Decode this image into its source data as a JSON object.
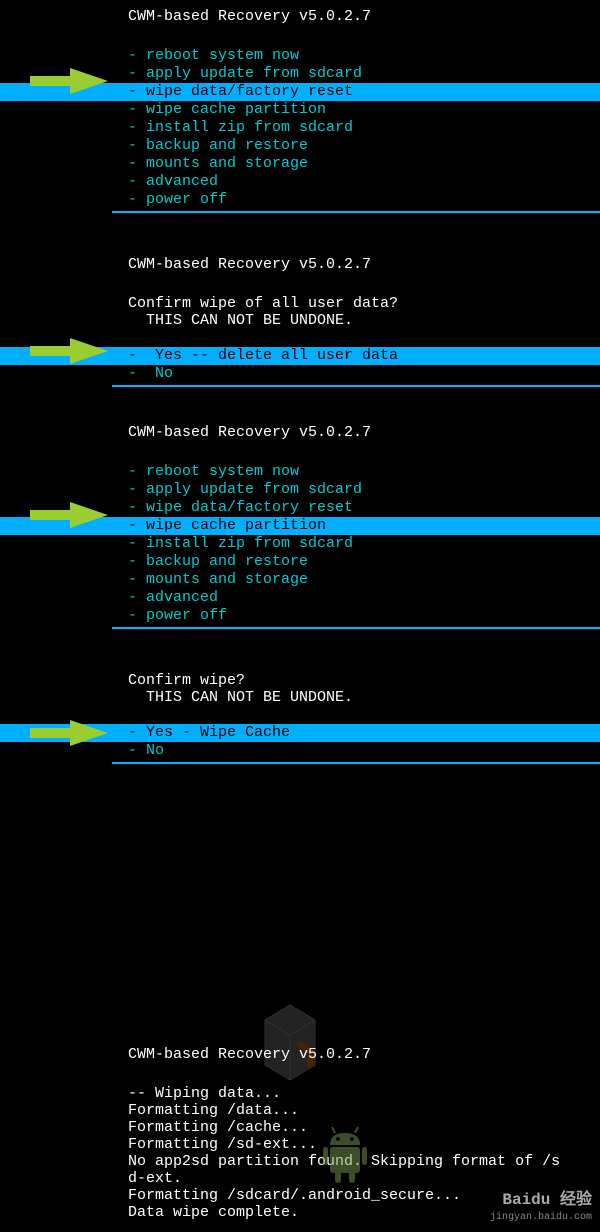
{
  "header": "CWM-based Recovery v5.0.2.7",
  "menu1": {
    "items": [
      "- reboot system now",
      "- apply update from sdcard",
      "- wipe data/factory reset",
      "- wipe cache partition",
      "- install zip from sdcard",
      "- backup and restore",
      "- mounts and storage",
      "- advanced",
      "- power off"
    ],
    "selected_index": 2
  },
  "confirm1": {
    "prompt": "Confirm wipe of all user data?",
    "warning": "  THIS CAN NOT BE UNDONE.",
    "options": [
      "-  Yes -- delete all user data",
      "-  No"
    ],
    "selected_index": 0
  },
  "menu2": {
    "items": [
      "- reboot system now",
      "- apply update from sdcard",
      "- wipe data/factory reset",
      "- wipe cache partition",
      "- install zip from sdcard",
      "- backup and restore",
      "- mounts and storage",
      "- advanced",
      "- power off"
    ],
    "selected_index": 3
  },
  "confirm2": {
    "prompt": "Confirm wipe?",
    "warning": "  THIS CAN NOT BE UNDONE.",
    "options": [
      "- Yes - Wipe Cache",
      "- No"
    ],
    "selected_index": 0
  },
  "log": {
    "lines": [
      "-- Wiping data...",
      "Formatting /data...",
      "Formatting /cache...",
      "Formatting /sd-ext...",
      "No app2sd partition found. Skipping format of /s",
      "d-ext.",
      "Formatting /sdcard/.android_secure...",
      "Data wipe complete."
    ]
  },
  "watermark": {
    "brand": "Baidu 经验",
    "url": "jingyan.baidu.com"
  },
  "arrow_color": "#9acd32"
}
